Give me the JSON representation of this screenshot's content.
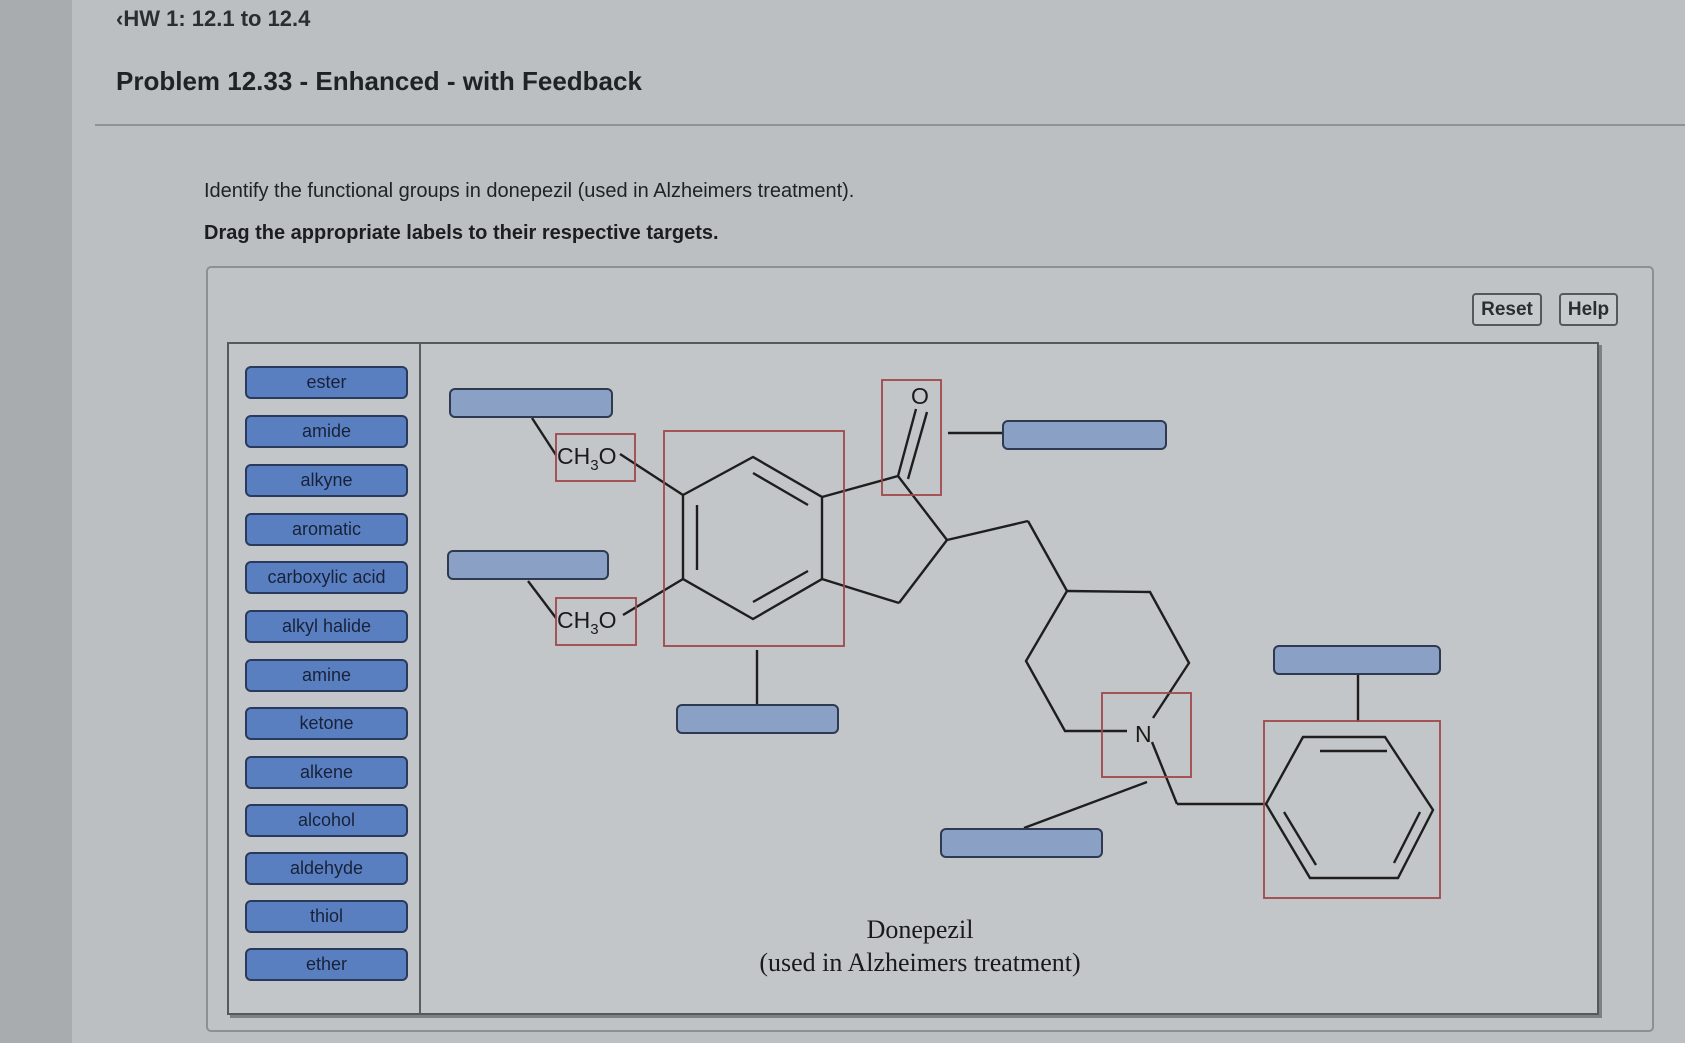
{
  "header": {
    "breadcrumb": "‹HW 1: 12.1 to 12.4",
    "title": "Problem 12.33 - Enhanced - with Feedback"
  },
  "question": {
    "instruction": "Identify the functional groups in donepezil (used in Alzheimers treatment).",
    "directive": "Drag the appropriate labels to their respective targets."
  },
  "toolbar": {
    "reset_label": "Reset",
    "help_label": "Help"
  },
  "labels": [
    {
      "text": "ester"
    },
    {
      "text": "amide"
    },
    {
      "text": "alkyne"
    },
    {
      "text": "aromatic"
    },
    {
      "text": "carboxylic acid"
    },
    {
      "text": "alkyl halide"
    },
    {
      "text": "amine"
    },
    {
      "text": "ketone"
    },
    {
      "text": "alkene"
    },
    {
      "text": "alcohol"
    },
    {
      "text": "aldehyde"
    },
    {
      "text": "thiol"
    },
    {
      "text": "ether"
    }
  ],
  "molecule": {
    "name": "Donepezil",
    "subtitle": "(used in Alzheimers treatment)",
    "atoms": {
      "methoxy_1": "CH₃O",
      "methoxy_2": "CH₃O",
      "carbonyl_oxygen": "O",
      "nitrogen": "N"
    },
    "drop_targets": [
      {
        "id": "target-methoxy-top",
        "value": ""
      },
      {
        "id": "target-methoxy-bottom",
        "value": ""
      },
      {
        "id": "target-fused-benzene",
        "value": ""
      },
      {
        "id": "target-carbonyl",
        "value": ""
      },
      {
        "id": "target-amine",
        "value": ""
      },
      {
        "id": "target-benzyl-ring",
        "value": ""
      }
    ]
  },
  "colors": {
    "label_fill": "#5a7fc0",
    "target_fill": "#8aa0c4",
    "highlight_box": "#a0484a"
  }
}
